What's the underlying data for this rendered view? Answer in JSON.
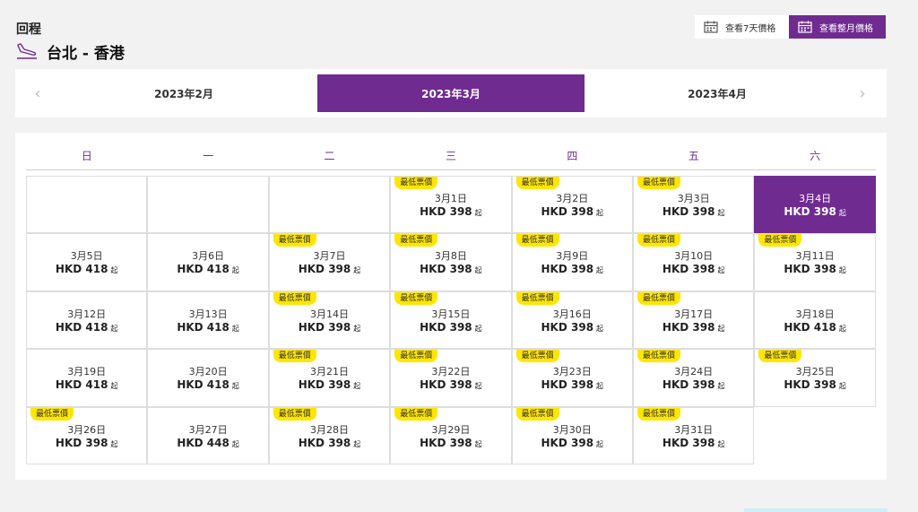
{
  "header": {
    "title": "回程",
    "route": "台北 - 香港"
  },
  "view_toggle": {
    "week_label": "查看7天價格",
    "month_label": "查看整月價格"
  },
  "month_nav": {
    "prev_arrow": "‹",
    "next_arrow": "›",
    "months": [
      "2023年2月",
      "2023年3月",
      "2023年4月"
    ],
    "selected": "2023年3月"
  },
  "calendar": {
    "weekdays": [
      "日",
      "一",
      "二",
      "三",
      "四",
      "五",
      "六"
    ],
    "lowest_tag": "最低票價",
    "from_suffix": "起",
    "colors": {
      "accent": "#702b91",
      "tag": "#ffe600"
    },
    "days": [
      {
        "date": "3月1日",
        "price": "HKD 398",
        "lowest": true
      },
      {
        "date": "3月2日",
        "price": "HKD 398",
        "lowest": true
      },
      {
        "date": "3月3日",
        "price": "HKD 398",
        "lowest": true
      },
      {
        "date": "3月4日",
        "price": "HKD 398",
        "lowest": false,
        "selected": true
      },
      {
        "date": "3月5日",
        "price": "HKD 418",
        "lowest": false
      },
      {
        "date": "3月6日",
        "price": "HKD 418",
        "lowest": false
      },
      {
        "date": "3月7日",
        "price": "HKD 398",
        "lowest": true
      },
      {
        "date": "3月8日",
        "price": "HKD 398",
        "lowest": true
      },
      {
        "date": "3月9日",
        "price": "HKD 398",
        "lowest": true
      },
      {
        "date": "3月10日",
        "price": "HKD 398",
        "lowest": true
      },
      {
        "date": "3月11日",
        "price": "HKD 398",
        "lowest": true
      },
      {
        "date": "3月12日",
        "price": "HKD 418",
        "lowest": false
      },
      {
        "date": "3月13日",
        "price": "HKD 418",
        "lowest": false
      },
      {
        "date": "3月14日",
        "price": "HKD 398",
        "lowest": true
      },
      {
        "date": "3月15日",
        "price": "HKD 398",
        "lowest": true
      },
      {
        "date": "3月16日",
        "price": "HKD 398",
        "lowest": true
      },
      {
        "date": "3月17日",
        "price": "HKD 398",
        "lowest": true
      },
      {
        "date": "3月18日",
        "price": "HKD 418",
        "lowest": false
      },
      {
        "date": "3月19日",
        "price": "HKD 418",
        "lowest": false
      },
      {
        "date": "3月20日",
        "price": "HKD 418",
        "lowest": false
      },
      {
        "date": "3月21日",
        "price": "HKD 398",
        "lowest": true
      },
      {
        "date": "3月22日",
        "price": "HKD 398",
        "lowest": true
      },
      {
        "date": "3月23日",
        "price": "HKD 398",
        "lowest": true
      },
      {
        "date": "3月24日",
        "price": "HKD 398",
        "lowest": true
      },
      {
        "date": "3月25日",
        "price": "HKD 398",
        "lowest": true
      },
      {
        "date": "3月26日",
        "price": "HKD 398",
        "lowest": true
      },
      {
        "date": "3月27日",
        "price": "HKD 448",
        "lowest": false
      },
      {
        "date": "3月28日",
        "price": "HKD 398",
        "lowest": true
      },
      {
        "date": "3月29日",
        "price": "HKD 398",
        "lowest": true
      },
      {
        "date": "3月30日",
        "price": "HKD 398",
        "lowest": true
      },
      {
        "date": "3月31日",
        "price": "HKD 398",
        "lowest": true
      }
    ]
  }
}
